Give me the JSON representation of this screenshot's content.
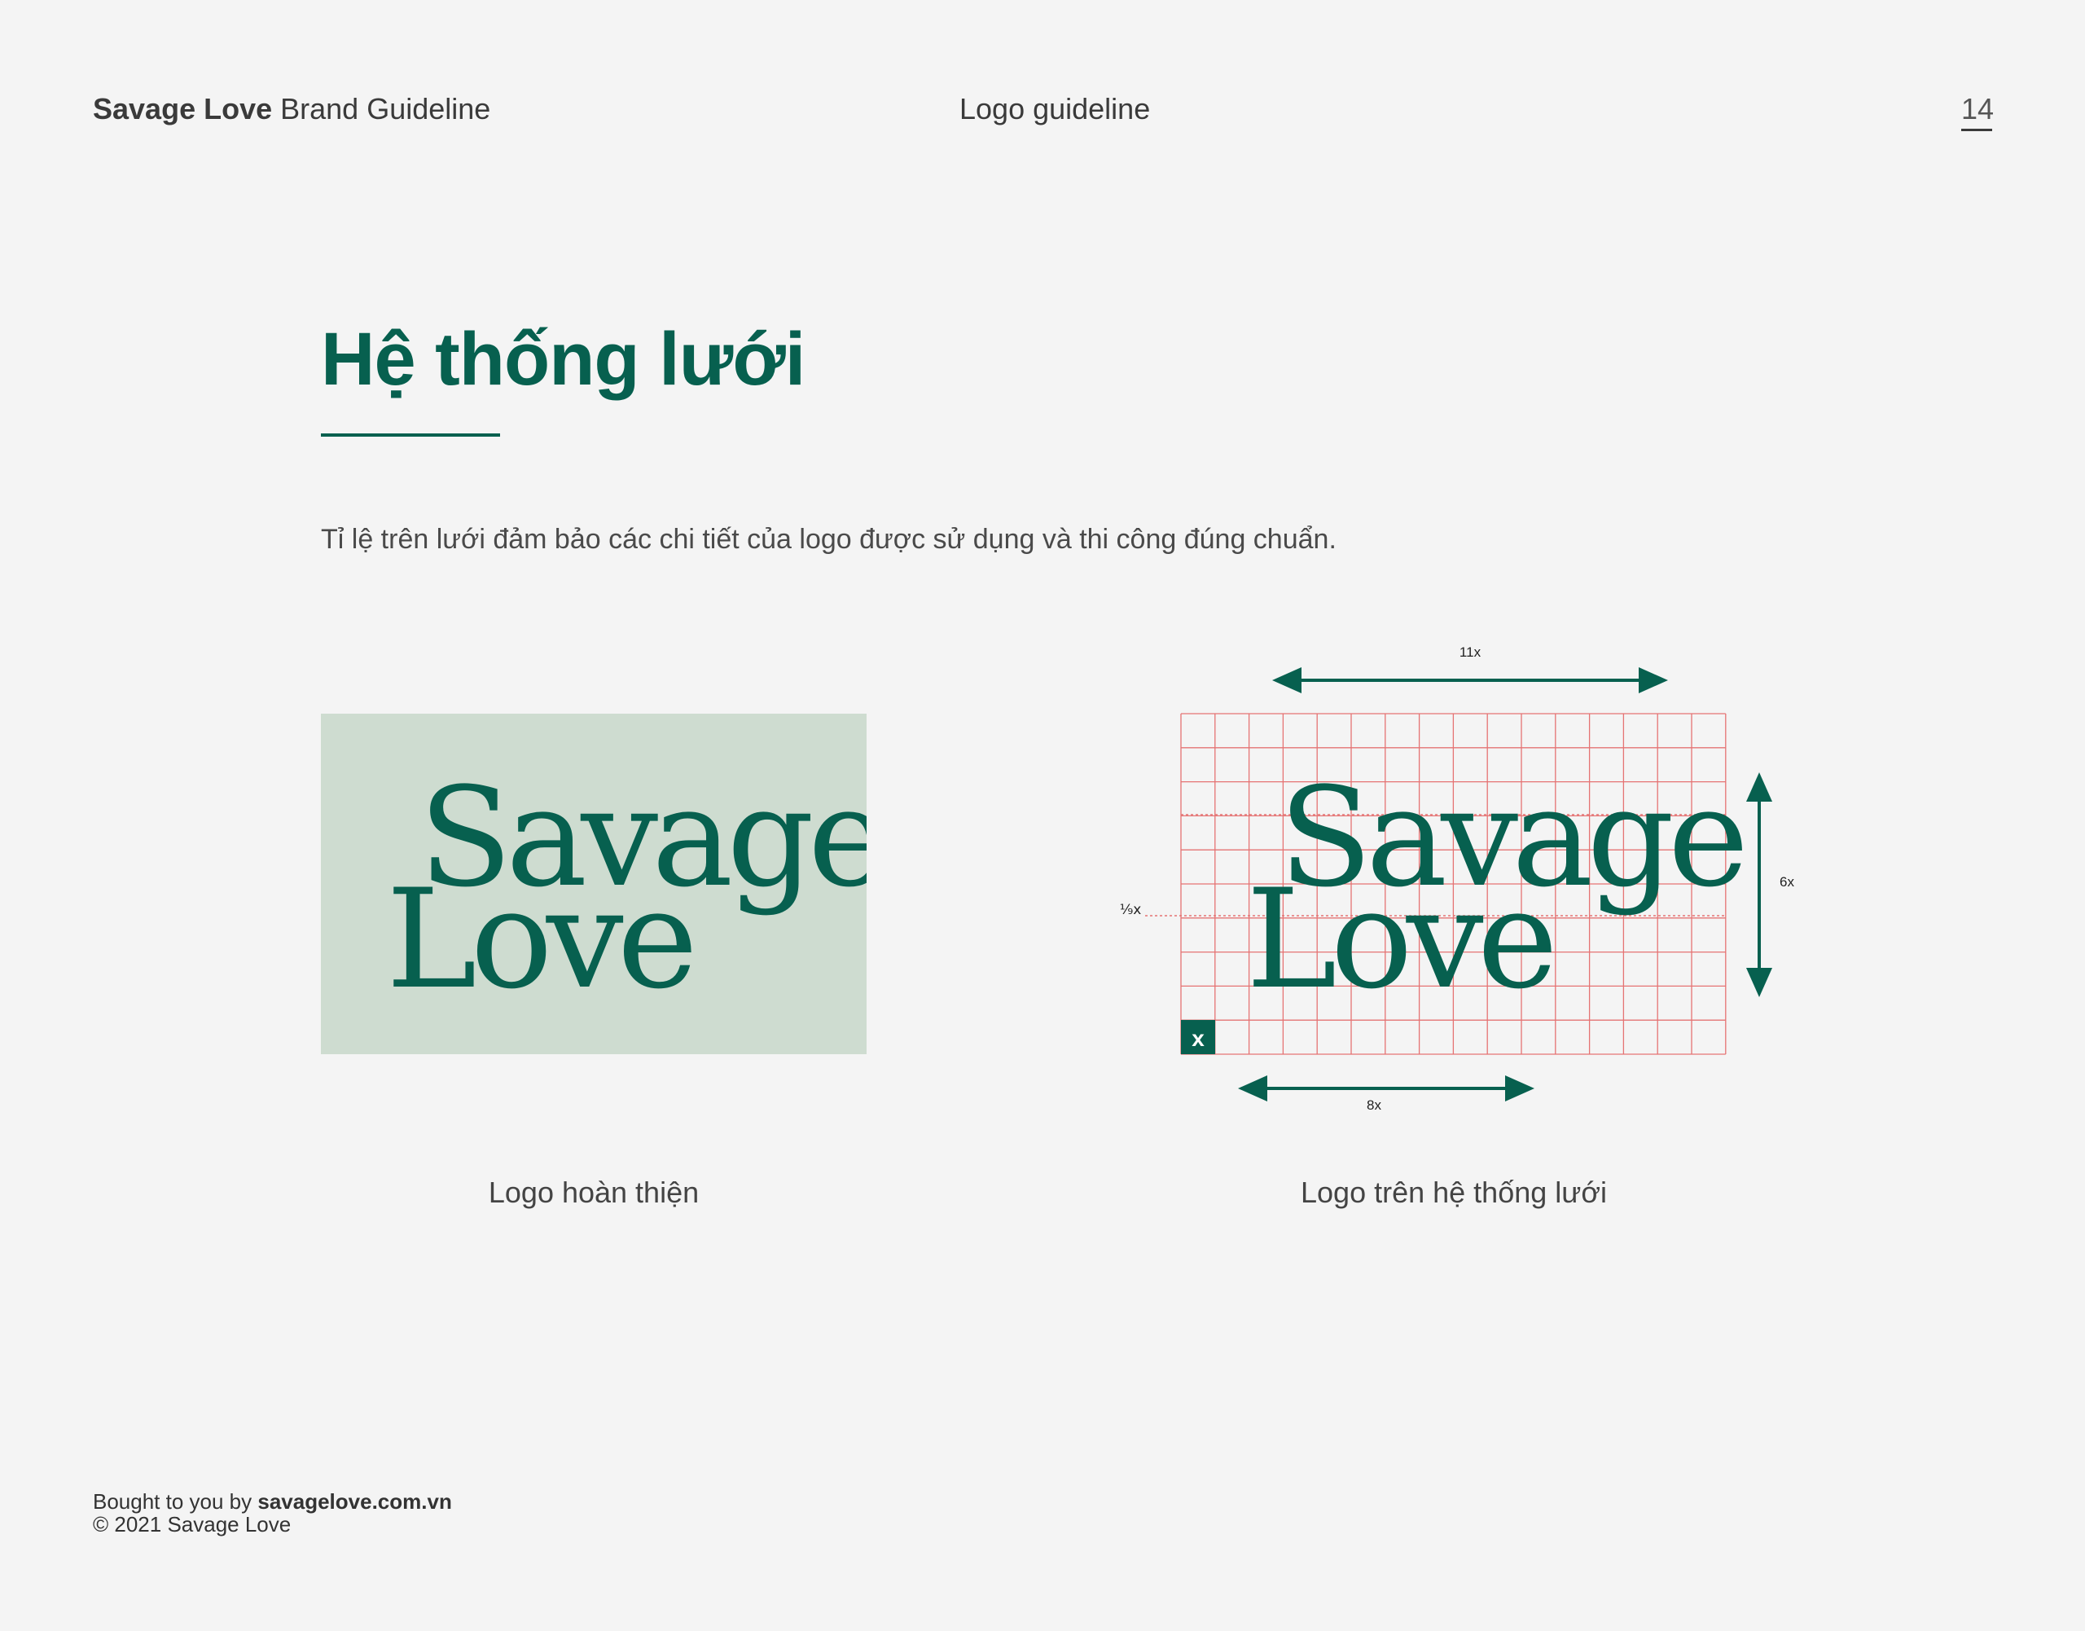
{
  "header": {
    "brand_bold": "Savage Love",
    "brand_rest": "Brand Guideline",
    "section": "Logo guideline",
    "page_number": "14"
  },
  "main": {
    "title": "Hệ thống lưới",
    "description": "Tỉ lệ trên lưới đảm bảo các chi tiết của logo được sử dụng và thi công đúng chuẩn."
  },
  "logo": {
    "line1": "Savage",
    "line2": "Love"
  },
  "grid_diagram": {
    "width_label": "11x",
    "height_label": "6x",
    "bottom_label": "8x",
    "offset_label": "⅑x",
    "unit_label": "x"
  },
  "captions": {
    "left": "Logo hoàn thiện",
    "right": "Logo trên hệ thống lưới"
  },
  "footer": {
    "bought_prefix": "Bought to you by",
    "site": "savagelove.com.vn",
    "copyright": "© 2021 Savage Love"
  },
  "colors": {
    "brand_green": "#07604f",
    "logo_bg": "#cedcd0",
    "grid_line": "#e57373",
    "background": "#f4f4f4"
  }
}
